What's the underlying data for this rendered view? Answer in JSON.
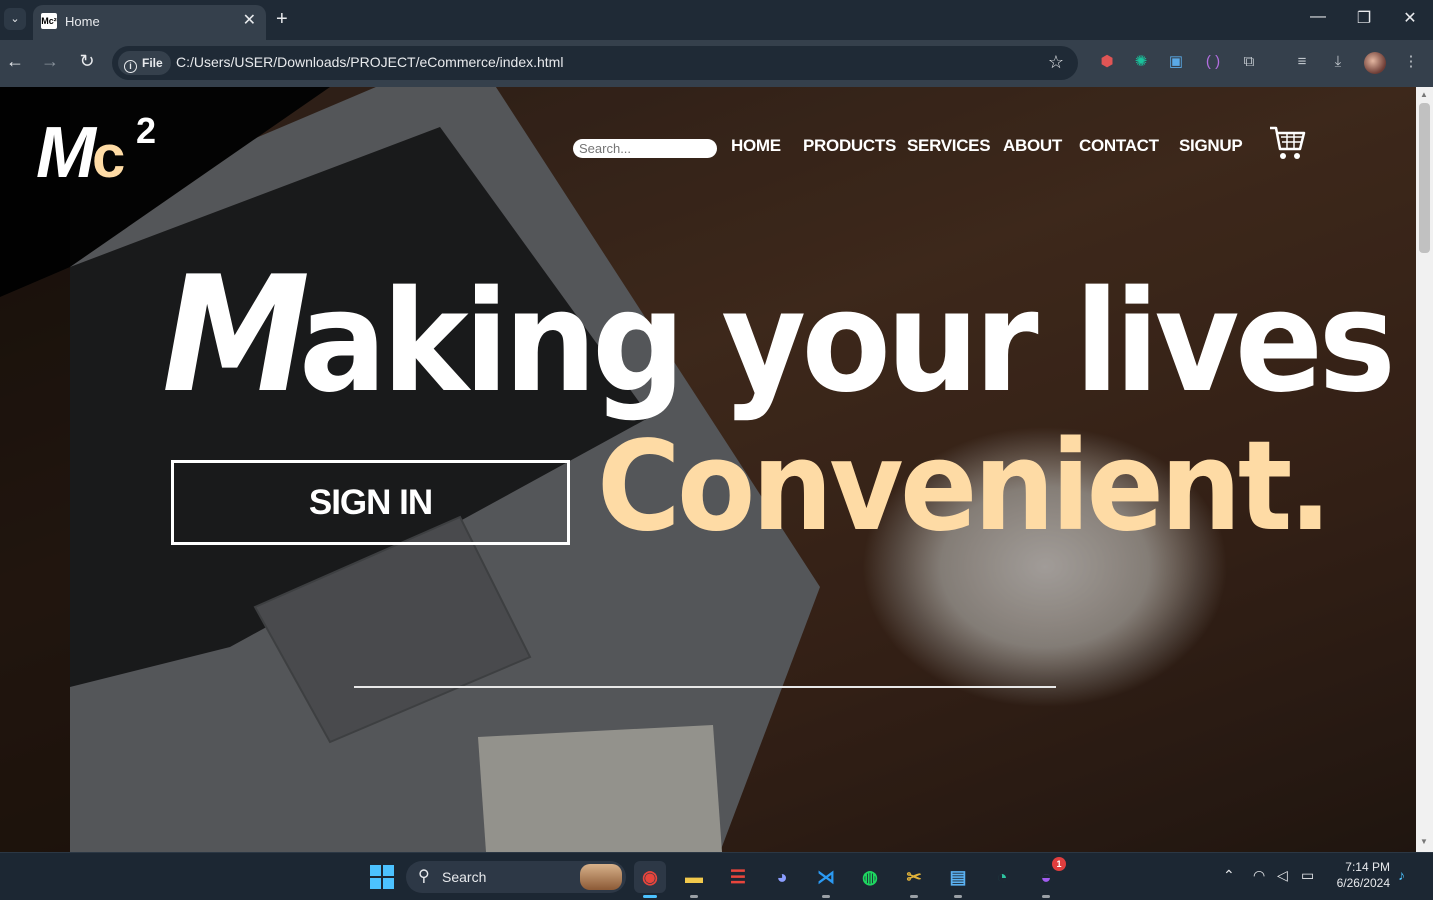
{
  "browser": {
    "tab_title": "Home",
    "favicon_text": "Mc²",
    "file_chip": "File",
    "url": "C:/Users/USER/Downloads/PROJECT/eCommerce/index.html"
  },
  "site": {
    "logo_text": "Mc",
    "logo_sup": "2",
    "search_placeholder": "Search...",
    "nav": [
      "HOME",
      "PRODUCTS",
      "SERVICES",
      "ABOUT",
      "CONTACT",
      "SIGNUP"
    ],
    "headline_first_letter": "M",
    "headline_rest": "aking your lives",
    "headline_accent": "Convenient.",
    "signin_label": "SIGN IN",
    "accent_color": "#fedba5"
  },
  "taskbar": {
    "search_label": "Search",
    "time": "7:14 PM",
    "date": "6/26/2024",
    "messenger_badge": "1"
  }
}
